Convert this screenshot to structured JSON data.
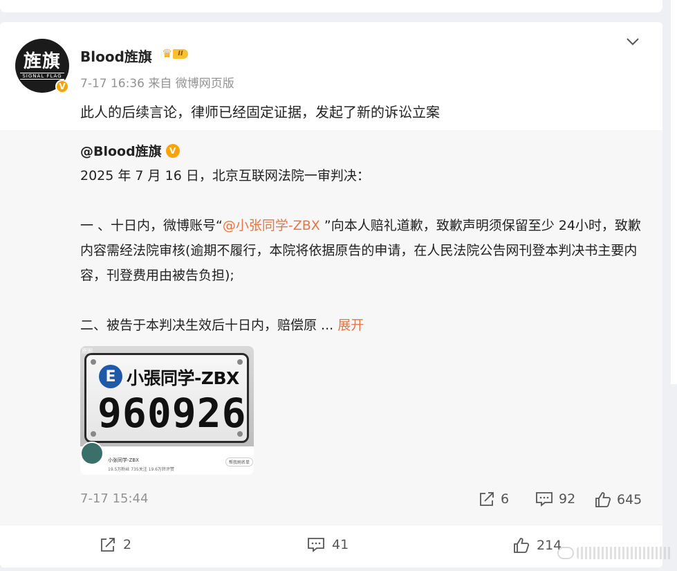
{
  "post": {
    "author": "Blood旌旗",
    "avatar_text": "旌旗",
    "avatar_subtext": "SIGNAL FLAG",
    "level_badge": "II",
    "timestamp": "7-17 16:36",
    "source": "来自 微博网页版",
    "text": "此人的后续言论，律师已经固定证据，发起了新的诉讼立案"
  },
  "repost": {
    "author": "@Blood旌旗",
    "paragraph1": "2025 年 7 月 16 日，北京互联网法院一审判决：",
    "p2_before": "一 、十日内，微博账号“",
    "p2_link": "@小张同学-ZBX",
    "p2_after": " ”向本人赔礼道歉，致歉声明须保留至少 24小时，致歉内容需经法院审核(逾期不履行，本院将依据原告的申请，在人民法院公告网刊登本判决书主要内容，刊登费用由被告负担);",
    "p3_text": "二、被告于本判决生效后十日内，赔偿原  ... ",
    "expand_label": "展开",
    "image": {
      "plate_letter": "E",
      "plate_top": "小張同学-ZBX",
      "plate_number": "960926",
      "mini_name": "小张同学-ZBX",
      "mini_stats": "19.5万粉丝   735关注   19.6万转评赞",
      "mini_button": "帮我刷名单",
      "tag": "原图"
    },
    "time": "7-17 15:44",
    "reposts": "6",
    "comments": "92",
    "likes": "645"
  },
  "footer": {
    "reposts": "2",
    "comments": "41",
    "likes": "214"
  }
}
